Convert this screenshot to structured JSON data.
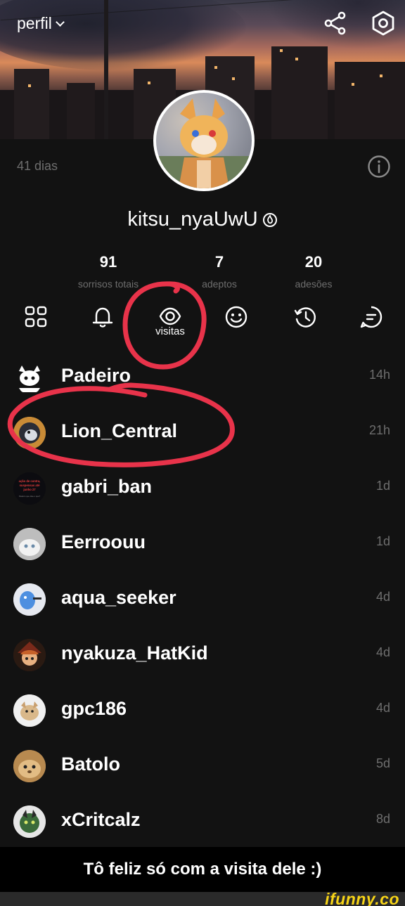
{
  "header": {
    "title": "perfil",
    "share_icon": "share-icon",
    "settings_icon": "settings-icon"
  },
  "profile": {
    "days": "41 dias",
    "username": "kitsu_nyaUwU",
    "verified_icon": "verified-icon",
    "stats": [
      {
        "value": "91",
        "label": "sorrisos totais"
      },
      {
        "value": "7",
        "label": "adeptos"
      },
      {
        "value": "20",
        "label": "adesões"
      }
    ]
  },
  "tabs": {
    "active_label": "visitas",
    "icons": [
      "grid-icon",
      "bell-icon",
      "eye-icon",
      "smile-icon",
      "history-icon",
      "chat-icon"
    ]
  },
  "visitors": [
    {
      "name": "Padeiro",
      "time": "14h"
    },
    {
      "name": "Lion_Central",
      "time": "21h"
    },
    {
      "name": "gabri_ban",
      "time": "1d",
      "avatar_text": [
        "ação de contra,",
        "suspensas até",
        "junho 27",
        "Padeiro que dise o que?"
      ]
    },
    {
      "name": "Eerroouu",
      "time": "1d"
    },
    {
      "name": "aqua_seeker",
      "time": "4d"
    },
    {
      "name": "nyakuza_HatKid",
      "time": "4d"
    },
    {
      "name": "gpc186",
      "time": "4d"
    },
    {
      "name": "Batolo",
      "time": "5d"
    },
    {
      "name": "xCritcalz",
      "time": "8d"
    }
  ],
  "caption": "Tô feliz só com a visita dele :)",
  "watermark": "ifunny.co",
  "colors": {
    "background": "#121212",
    "muted_text": "#6e6e6e",
    "annotation_red": "#e8334a",
    "watermark_yellow": "#f7d417"
  }
}
